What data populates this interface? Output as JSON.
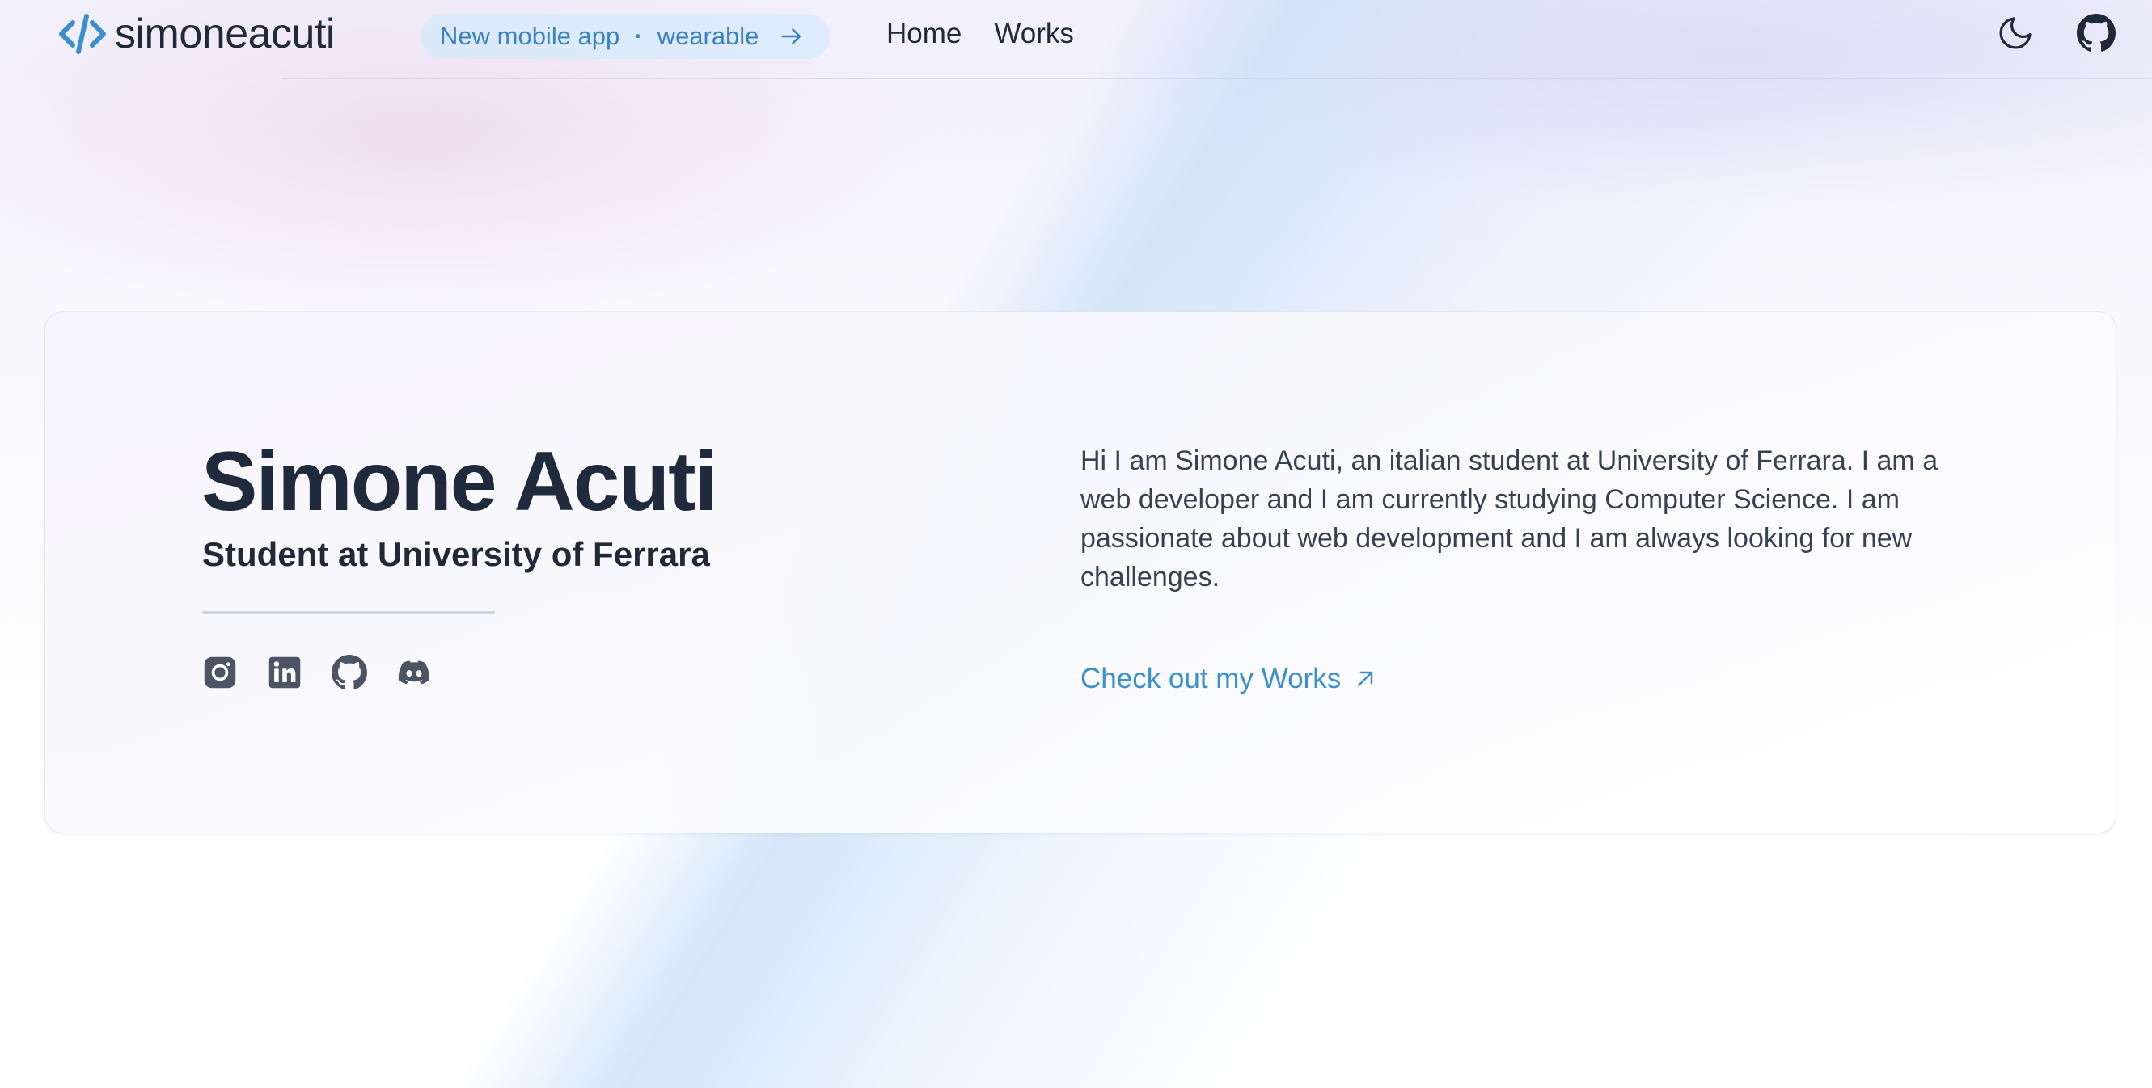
{
  "header": {
    "logo_text": "simoneacuti",
    "announcement": {
      "left": "New mobile app",
      "separator": "·",
      "right": "wearable"
    },
    "nav": [
      {
        "label": "Home"
      },
      {
        "label": "Works"
      }
    ],
    "actions": [
      "moon-icon",
      "github-icon"
    ]
  },
  "hero": {
    "name": "Simone Acuti",
    "subtitle": "Student at University of Ferrara",
    "bio": "Hi I am Simone Acuti, an italian student at University of Ferrara. I am a web developer and I am currently studying Computer Science. I am passionate about web development and I am always looking for new challenges.",
    "cta_label": "Check out my Works",
    "socials": [
      "instagram-icon",
      "linkedin-icon",
      "github-icon",
      "discord-icon"
    ]
  },
  "colors": {
    "accent": "#3a8fd0",
    "heading": "#1f2a3d",
    "body_text": "#374151",
    "announcement_bg": "#d6eafc"
  }
}
